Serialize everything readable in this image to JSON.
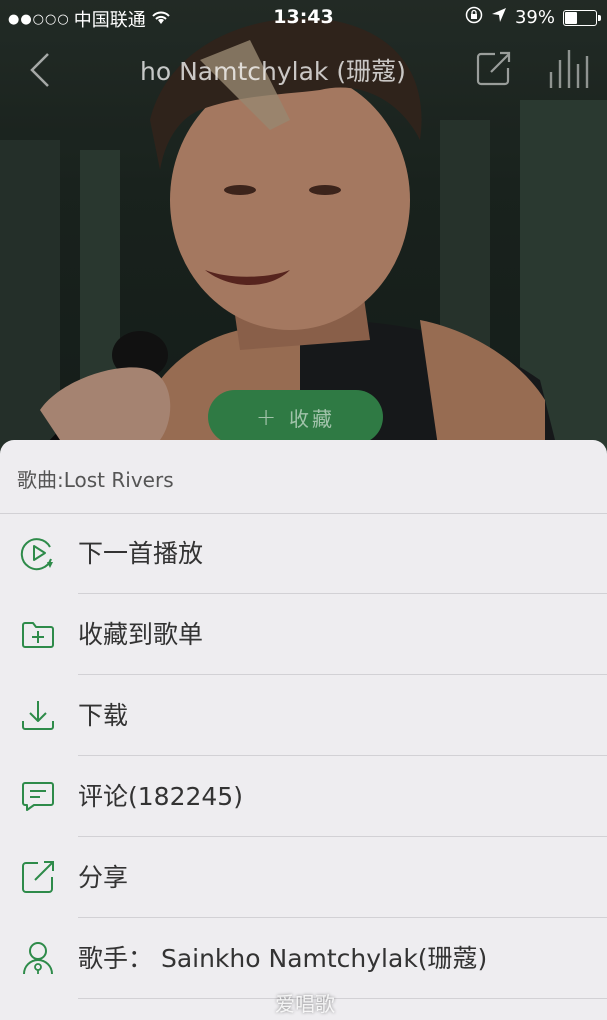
{
  "status_bar": {
    "signal": "●●○○○",
    "carrier": "中国联通",
    "time": "13:43",
    "battery_text": "39%",
    "battery_level": 0.39
  },
  "nav": {
    "title": "ho Namtchylak (珊蔻)"
  },
  "collect_button": {
    "plus": "+",
    "label": "收藏"
  },
  "sheet": {
    "header": "歌曲:Lost Rivers",
    "items": [
      {
        "label": "下一首播放",
        "icon": "play-next-icon"
      },
      {
        "label": "收藏到歌单",
        "icon": "add-to-playlist-icon"
      },
      {
        "label": "下载",
        "icon": "download-icon"
      },
      {
        "label": "评论(182245)",
        "icon": "comment-icon"
      },
      {
        "label": "分享",
        "icon": "share-icon"
      },
      {
        "label": "歌手：  Sainkho Namtchylak(珊蔻)",
        "icon": "artist-icon"
      }
    ]
  },
  "watermark": "爱唱歌",
  "colors": {
    "accent": "#2e8b4a",
    "sheet_bg": "#eeedf0",
    "button_bg": "#2f7a44"
  }
}
